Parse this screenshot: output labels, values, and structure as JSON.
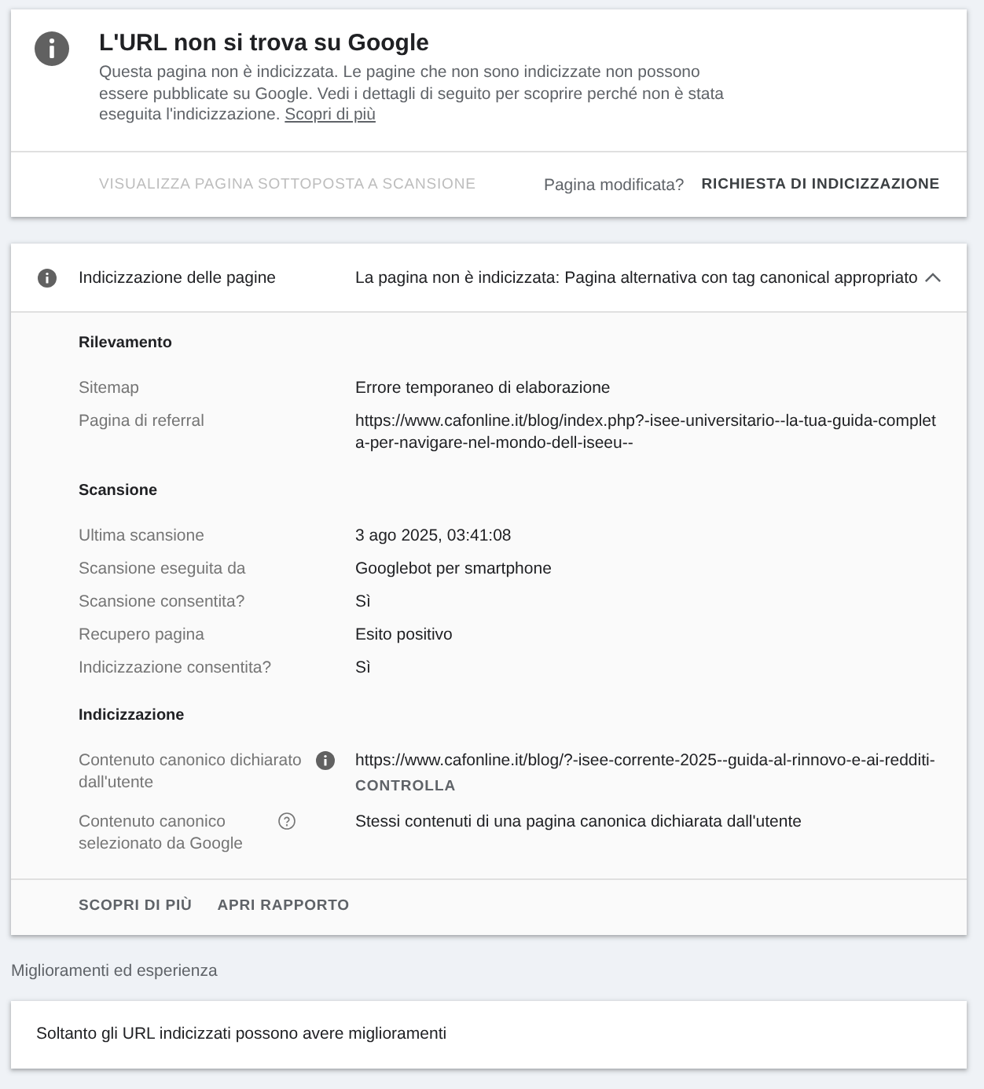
{
  "status_card": {
    "title": "L'URL non si trova su Google",
    "description": "Questa pagina non è indicizzata. Le pagine che non sono indicizzate non possono essere pubblicate su Google. Vedi i dettagli di seguito per scoprire perché non è stata eseguita l'indicizzazione.",
    "link": "Scopri di più",
    "view_button": {
      "label": "VISUALIZZA PAGINA SOTTOPOSTA A SCANSIONE",
      "disabled": true
    },
    "prompt": "Pagina modificata?",
    "request_button": "RICHIESTA DI INDICIZZAZIONE"
  },
  "indexing_panel": {
    "title": "Indicizzazione delle pagine",
    "status": "La pagina non è indicizzata: Pagina alternativa con tag canonical appropriato",
    "expanded": true,
    "sections": [
      {
        "heading": "Rilevamento",
        "rows": [
          {
            "kind": "plain",
            "label": "Sitemap",
            "value": "Errore temporaneo di elaborazione"
          },
          {
            "kind": "plain",
            "label": "Pagina di referral",
            "value": "https://www.cafonline.it/blog/index.php?-isee-universitario--la-tua-guida-completa-per-navigare-nel-mondo-dell-iseeu--"
          }
        ]
      },
      {
        "heading": "Scansione",
        "rows": [
          {
            "kind": "plain",
            "label": "Ultima scansione",
            "value": "3 ago 2025, 03:41:08"
          },
          {
            "kind": "plain",
            "label": "Scansione eseguita da",
            "value": "Googlebot per smartphone"
          },
          {
            "kind": "plain",
            "label": "Scansione consentita?",
            "value": "Sì"
          },
          {
            "kind": "plain",
            "label": "Recupero pagina",
            "value": "Esito positivo"
          },
          {
            "kind": "plain",
            "label": "Indicizzazione consentita?",
            "value": "Sì"
          }
        ]
      },
      {
        "heading": "Indicizzazione",
        "rows": [
          {
            "kind": "declared_canonical",
            "label": "Contenuto canonico dichiarato dall'utente",
            "value": "https://www.cafonline.it/blog/?-isee-corrente-2025--guida-al-rinnovo-e-ai-redditi-",
            "action": "CONTROLLA"
          },
          {
            "kind": "selected_canonical",
            "label": "Contenuto canonico selezionato da Google",
            "value": "Stessi contenuti di una pagina canonica dichiarata dall'utente"
          }
        ]
      }
    ],
    "footer_links": [
      "SCOPRI DI PIÙ",
      "APRI RAPPORTO"
    ]
  },
  "enhancements": {
    "heading": "Miglioramenti ed esperienza",
    "message": "Soltanto gli URL indicizzati possono avere miglioramenti"
  }
}
